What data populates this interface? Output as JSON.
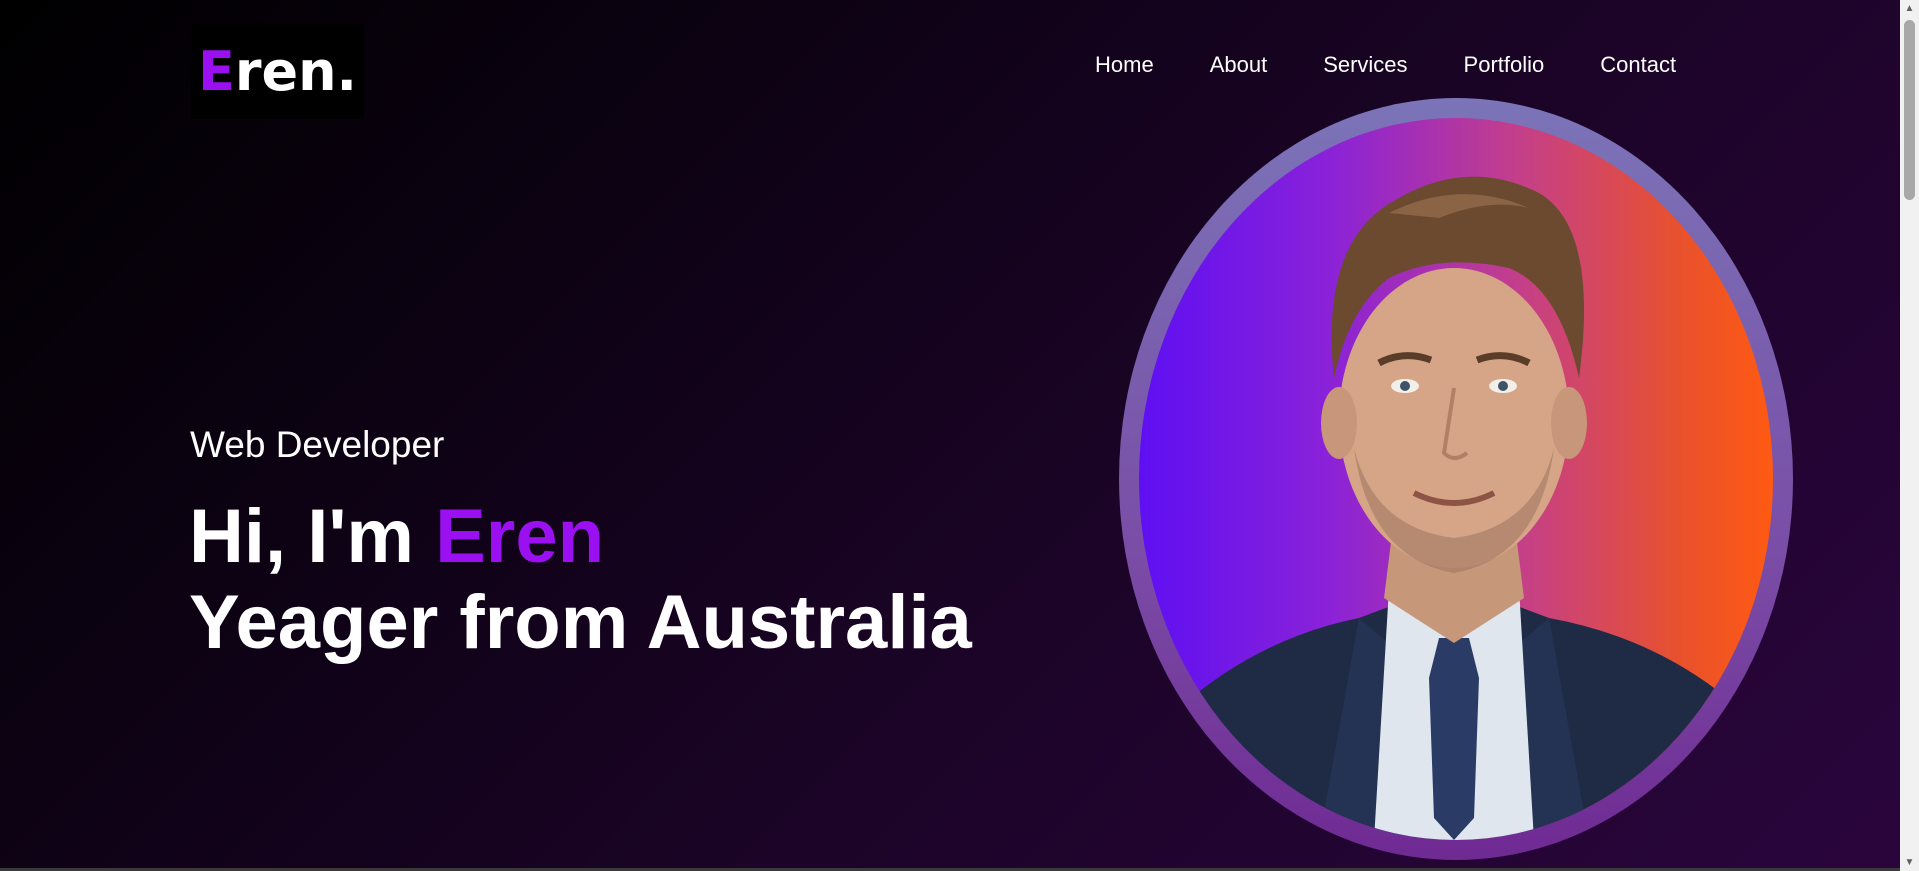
{
  "brand": {
    "logo_first": "E",
    "logo_rest": "ren.",
    "accent_color": "#9a10f0"
  },
  "nav": {
    "items": [
      {
        "label": "Home"
      },
      {
        "label": "About"
      },
      {
        "label": "Services"
      },
      {
        "label": "Portfolio"
      },
      {
        "label": "Contact"
      }
    ]
  },
  "hero": {
    "role": "Web Developer",
    "greeting": "Hi, I'm ",
    "name_highlight": "Eren",
    "line2": "Yeager from Australia",
    "portrait_alt": "portrait-photo"
  },
  "colors": {
    "background_dark": "#000000",
    "background_purple": "#2a053d",
    "portrait_gradient_start": "#5e0ff2",
    "portrait_gradient_end": "#ff5a12",
    "ring": "#7a4da6"
  },
  "scrollbar": {
    "up_icon": "chevron-up-icon",
    "down_icon": "chevron-down-icon"
  }
}
